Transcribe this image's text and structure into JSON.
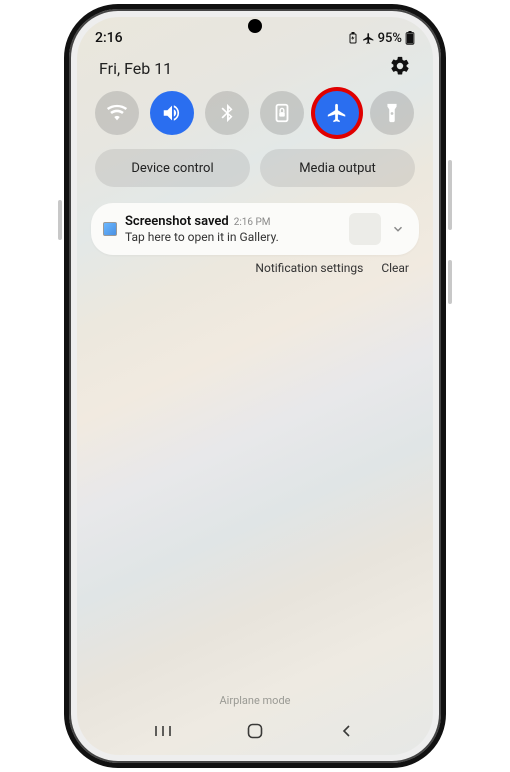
{
  "statusbar": {
    "time": "2:16",
    "battery_pct": "95%"
  },
  "panel": {
    "date": "Fri, Feb 11"
  },
  "chips": {
    "device_control": "Device control",
    "media_output": "Media output"
  },
  "notification": {
    "title": "Screenshot saved",
    "time": "2:16 PM",
    "text": "Tap here to open it in Gallery."
  },
  "footer": {
    "settings": "Notification settings",
    "clear": "Clear"
  },
  "bottom_label": "Airplane mode",
  "quick_settings": [
    {
      "name": "wifi",
      "on": false
    },
    {
      "name": "sound",
      "on": true
    },
    {
      "name": "bluetooth",
      "on": false
    },
    {
      "name": "rotation",
      "on": false
    },
    {
      "name": "airplane",
      "on": true,
      "highlighted": true
    },
    {
      "name": "flashlight",
      "on": false
    }
  ]
}
